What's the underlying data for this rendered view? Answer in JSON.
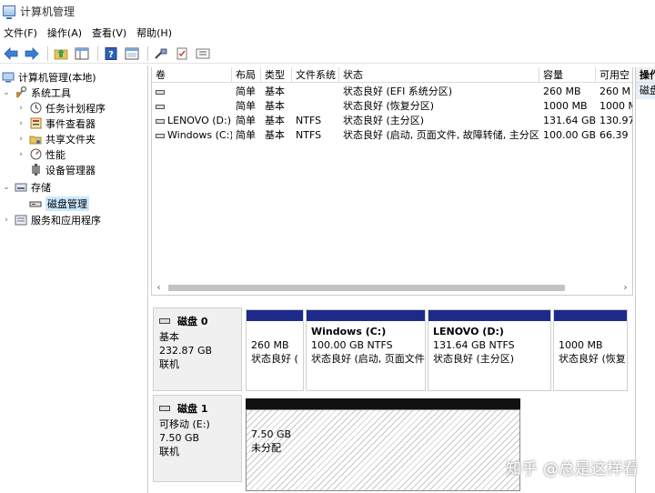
{
  "window": {
    "title": "计算机管理"
  },
  "menu": [
    "文件(F)",
    "操作(A)",
    "查看(V)",
    "帮助(H)"
  ],
  "toolbar": {
    "buttons": [
      "back-arrow-icon",
      "forward-arrow-icon",
      "up-folder-icon",
      "show-hide-tree-icon",
      "help-icon",
      "view-icon",
      "connect-icon",
      "checklist-icon",
      "properties-icon"
    ]
  },
  "tree": {
    "root": "计算机管理(本地)",
    "system_tools": "系统工具",
    "task_scheduler": "任务计划程序",
    "event_viewer": "事件查看器",
    "shared_folders": "共享文件夹",
    "performance": "性能",
    "device_manager": "设备管理器",
    "storage": "存储",
    "disk_management": "磁盘管理",
    "services_apps": "服务和应用程序"
  },
  "volume_list": {
    "columns": [
      "卷",
      "布局",
      "类型",
      "文件系统",
      "状态",
      "容量",
      "可用空"
    ],
    "rows": [
      {
        "vol": "",
        "layout": "简单",
        "type": "基本",
        "fs": "",
        "status": "状态良好 (EFI 系统分区)",
        "capacity": "260 MB",
        "free": "260 M"
      },
      {
        "vol": "",
        "layout": "简单",
        "type": "基本",
        "fs": "",
        "status": "状态良好 (恢复分区)",
        "capacity": "1000 MB",
        "free": "1000 M"
      },
      {
        "vol": "LENOVO (D:)",
        "layout": "简单",
        "type": "基本",
        "fs": "NTFS",
        "status": "状态良好 (主分区)",
        "capacity": "131.64 GB",
        "free": "130.97"
      },
      {
        "vol": "Windows (C:)",
        "layout": "简单",
        "type": "基本",
        "fs": "NTFS",
        "status": "状态良好 (启动, 页面文件, 故障转储, 主分区)",
        "capacity": "100.00 GB",
        "free": "66.39"
      }
    ]
  },
  "actions": {
    "title": "操作",
    "item": "磁盘"
  },
  "disks": [
    {
      "name": "磁盘 0",
      "kind": "基本",
      "size": "232.87 GB",
      "state": "联机",
      "partitions": [
        {
          "name": "",
          "size": "260 MB",
          "status": "状态良好 ("
        },
        {
          "name": "Windows  (C:)",
          "size": "100.00 GB NTFS",
          "status": "状态良好 (启动, 页面文件"
        },
        {
          "name": "LENOVO  (D:)",
          "size": "131.64 GB NTFS",
          "status": "状态良好 (主分区)"
        },
        {
          "name": "",
          "size": "1000 MB",
          "status": "状态良好 (恢复"
        }
      ]
    },
    {
      "name": "磁盘 1",
      "kind": "可移动 (E:)",
      "size": "7.50 GB",
      "state": "联机",
      "partitions": [
        {
          "name": "",
          "size": "7.50 GB",
          "status": "未分配"
        }
      ]
    }
  ],
  "watermark": "知乎 @总是这样看"
}
